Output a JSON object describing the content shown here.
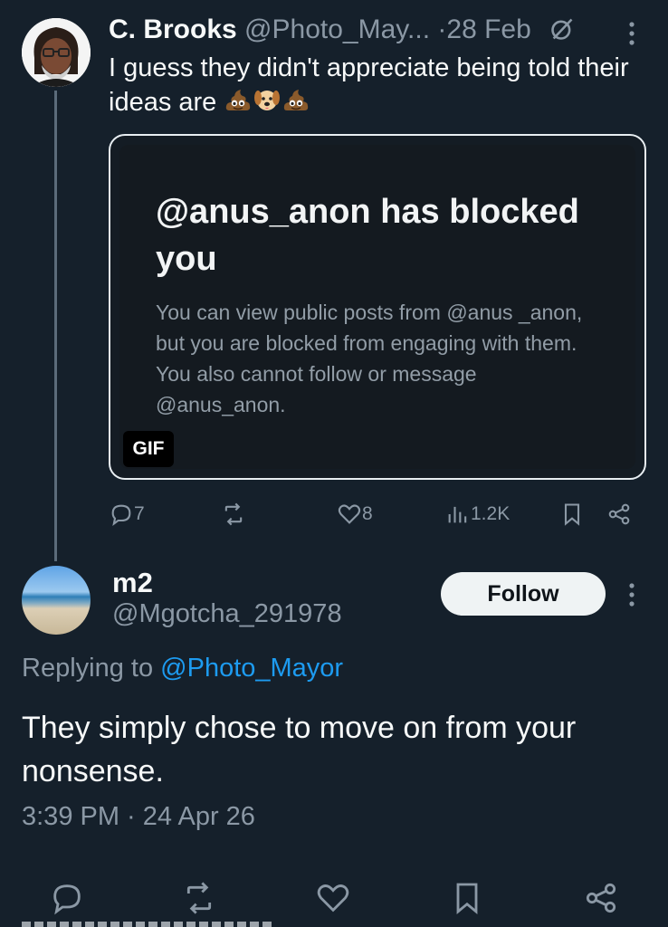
{
  "tweet1": {
    "name": "C. Brooks",
    "handle": "@Photo_May...",
    "separator": "·",
    "date": "28 Feb",
    "text": "I guess they didn't appreciate being told their ideas are",
    "emojis": [
      "pile-of-poo",
      "dog-face",
      "pile-of-poo"
    ],
    "media": {
      "title": "@anus_anon has blocked you",
      "description": "You can view public posts from @anus _anon, but you are blocked from engaging with them. You also cannot follow or message @anus_anon.",
      "badge": "GIF"
    },
    "actions": {
      "replies": "7",
      "likes": "8",
      "views": "1.2K"
    }
  },
  "tweet2": {
    "name": "m2",
    "handle": "@Mgotcha_291978",
    "follow_label": "Follow",
    "replying_prefix": "Replying to",
    "replying_handle": "@Photo_Mayor",
    "text": "They simply chose to move on from your nonsense.",
    "timestamp": "3:39 PM · 24 Apr 26"
  },
  "colors": {
    "background": "#15202b",
    "muted": "#8b98a5",
    "accent": "#1d9bf0",
    "text": "#f7f9f9"
  }
}
